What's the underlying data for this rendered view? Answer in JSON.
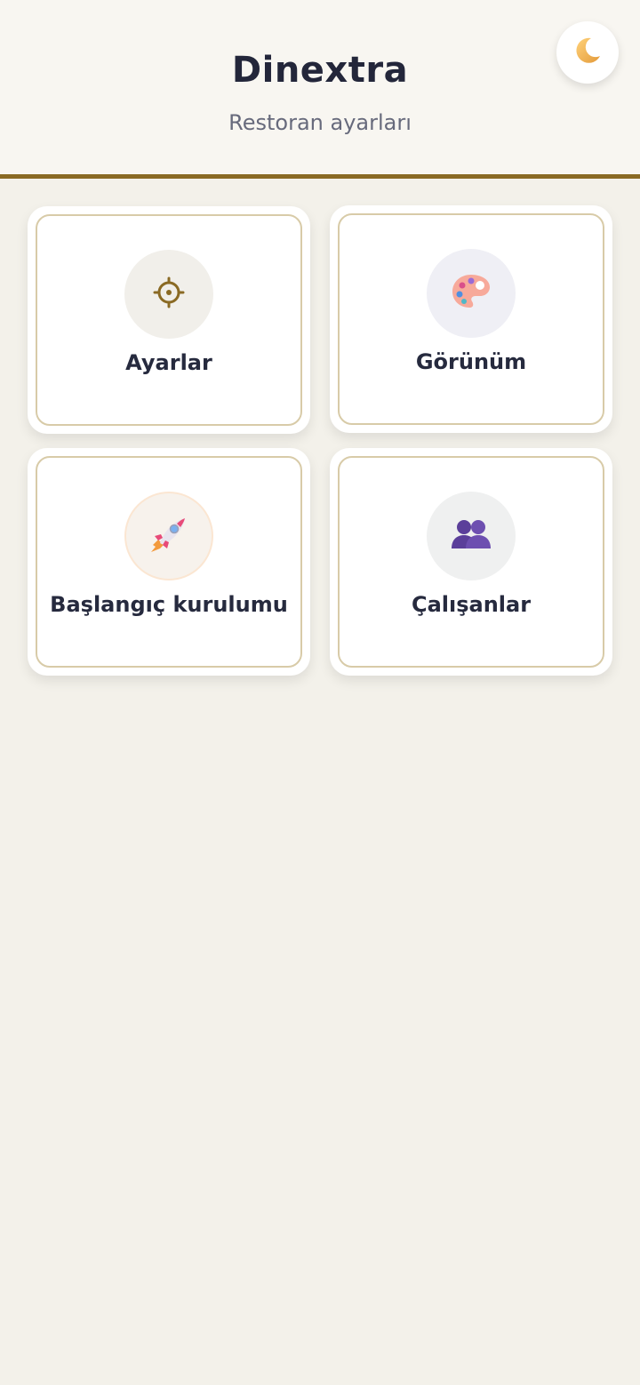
{
  "header": {
    "title": "Dinextra",
    "subtitle": "Restoran ayarları",
    "accent_color": "#8a6a24",
    "theme_toggle_icon": "moon-icon"
  },
  "cards": [
    {
      "label": "Ayarlar",
      "icon": "gear-icon"
    },
    {
      "label": "Görünüm",
      "icon": "palette-icon"
    },
    {
      "label": "Başlangıç kurulumu",
      "icon": "rocket-icon"
    },
    {
      "label": "Çalışanlar",
      "icon": "people-icon"
    }
  ]
}
